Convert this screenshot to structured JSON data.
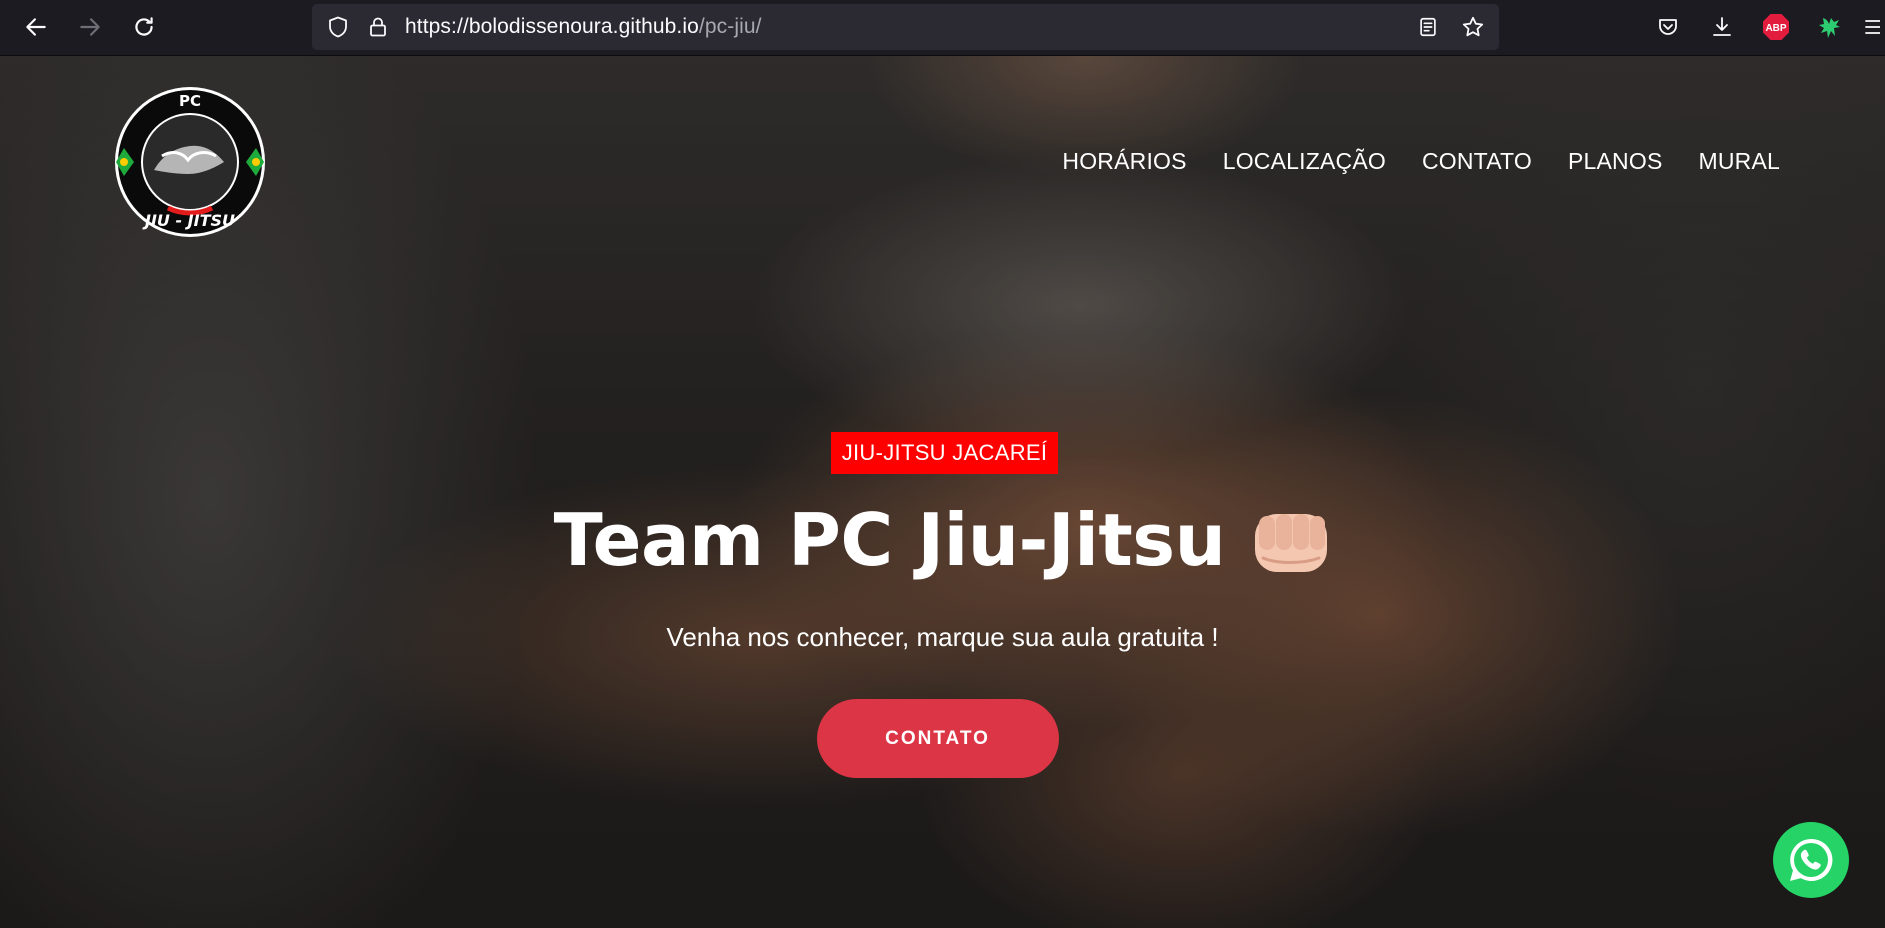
{
  "browser": {
    "url_host": "https://bolodissenoura.github.io",
    "url_path": "/pc-jiu/",
    "icons": {
      "back": "back-arrow-icon",
      "forward": "forward-arrow-icon",
      "reload": "reload-icon",
      "tracking": "shield-icon",
      "secure": "lock-icon",
      "reader": "reader-view-icon",
      "bookmark": "star-icon",
      "pocket": "pocket-icon",
      "downloads": "download-icon",
      "adblock": "abp-icon",
      "extension": "extension-icon",
      "menu": "menu-icon"
    },
    "adblock_label": "ABP"
  },
  "site": {
    "logo": {
      "top_text": "PC",
      "bottom_text": "JIU - JITSU"
    },
    "nav": {
      "items": [
        "HORÁRIOS",
        "LOCALIZAÇÃO",
        "CONTATO",
        "PLANOS",
        "MURAL"
      ]
    },
    "hero": {
      "badge": "JIU-JITSU JACAREÍ",
      "title": "Team PC Jiu-Jitsu",
      "title_emoji": "fist-icon",
      "subtitle": "Venha nos conhecer, marque sua aula gratuita !",
      "cta_label": "CONTATO"
    },
    "floating": {
      "whatsapp": "whatsapp-icon"
    },
    "colors": {
      "badge": "#ff0000",
      "cta": "#dc3545",
      "whatsapp": "#25d366"
    }
  }
}
